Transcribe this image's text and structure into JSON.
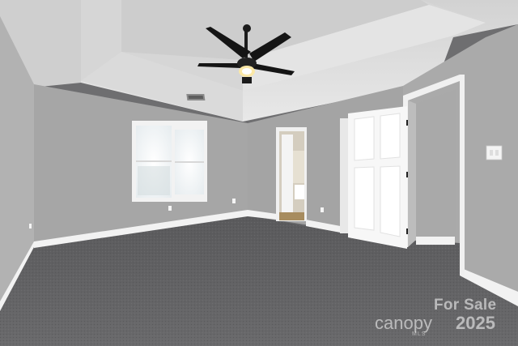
{
  "scene": {
    "description_colors": {
      "wall": "#a8a8a8",
      "ceiling": "#dedede",
      "carpet": "#5b5b5d",
      "trim": "#f4f4f4",
      "fan": "#1c1c1c"
    }
  },
  "watermark": {
    "line1": "For Sale",
    "brand": "canopy",
    "year": "2025",
    "sub": "MLS"
  }
}
